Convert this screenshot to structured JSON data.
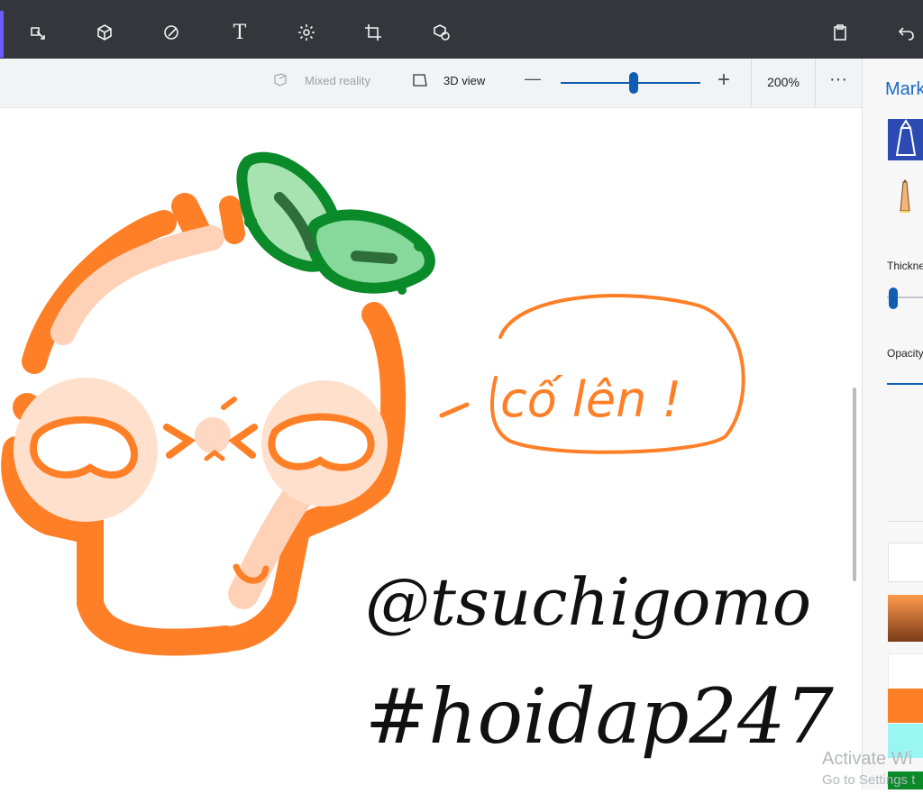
{
  "toolbar": {
    "icons": [
      "select-icon",
      "3d-shapes-icon",
      "stickers-icon",
      "text-icon",
      "effects-icon",
      "crop-icon",
      "3d-library-icon",
      "paste-icon",
      "undo-icon"
    ],
    "text_label": "T"
  },
  "subbar": {
    "mixed_reality": "Mixed reality",
    "view_3d": "3D view",
    "zoom_minus": "—",
    "zoom_plus": "+",
    "zoom_level": "200%",
    "more": "···"
  },
  "panel": {
    "title": "Mark",
    "thickness": "Thickne",
    "opacity": "Opacity"
  },
  "canvas": {
    "speech_text": "cố lên !",
    "watermark_1": "@tsuchigomo",
    "watermark_2": "#hoidap247",
    "activate_1": "Activate Wi",
    "activate_2": "Go to Settings t"
  }
}
